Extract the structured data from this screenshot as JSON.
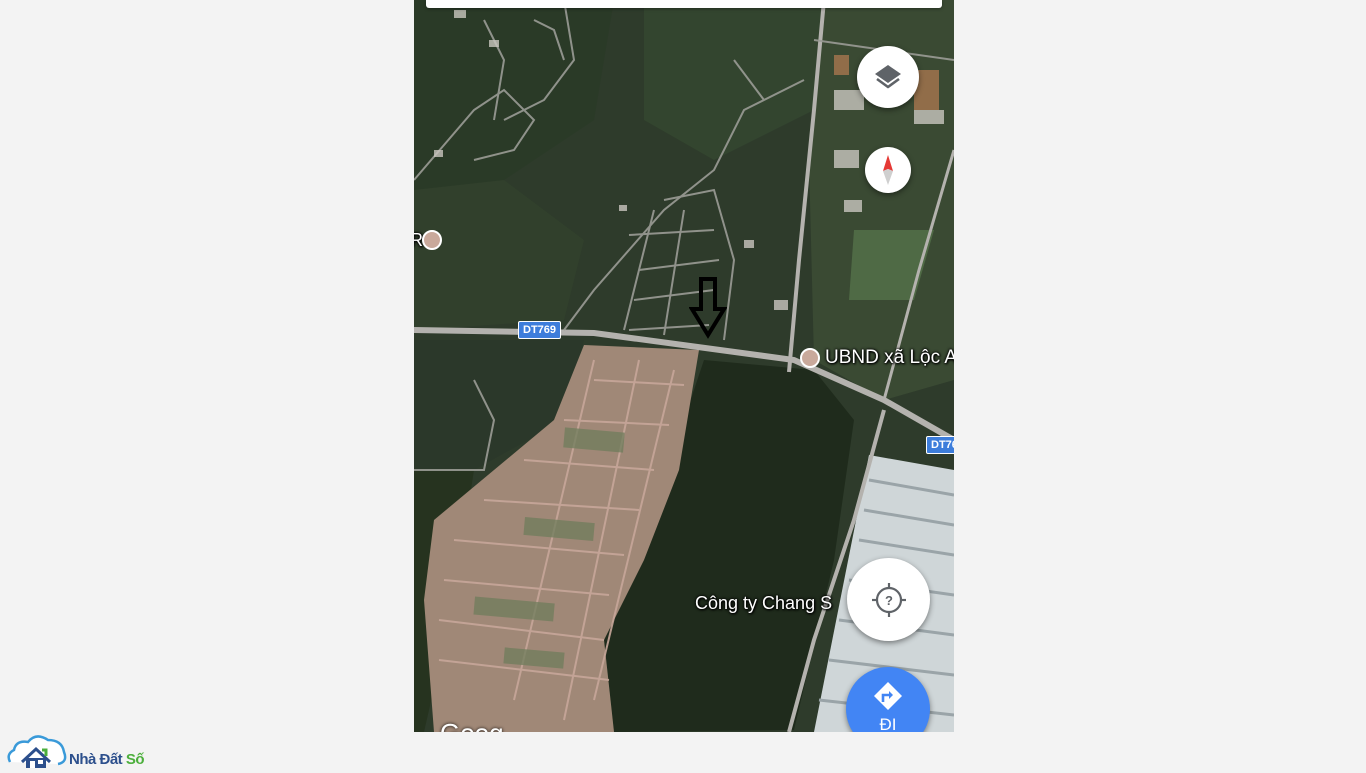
{
  "map": {
    "labels": {
      "ubnd": "UBND xã Lộc A",
      "company": "Công ty Chang S",
      "left_partial": "R"
    },
    "road_shields": [
      "DT769",
      "DT76"
    ],
    "google_logo": "Goog",
    "marker": "arrow-down-icon"
  },
  "controls": {
    "layers_icon": "layers-icon",
    "compass_icon": "compass-icon",
    "locate_icon": "crosshair-question-icon",
    "directions": {
      "label": "ĐI",
      "icon": "directions-icon",
      "color": "#4285f4"
    }
  },
  "watermark": {
    "part1": "Nhà Đất ",
    "part2": "Số",
    "icon": "house-cloud-icon",
    "colors": {
      "primary": "#2c4f8c",
      "accent": "#4caf3c"
    }
  }
}
